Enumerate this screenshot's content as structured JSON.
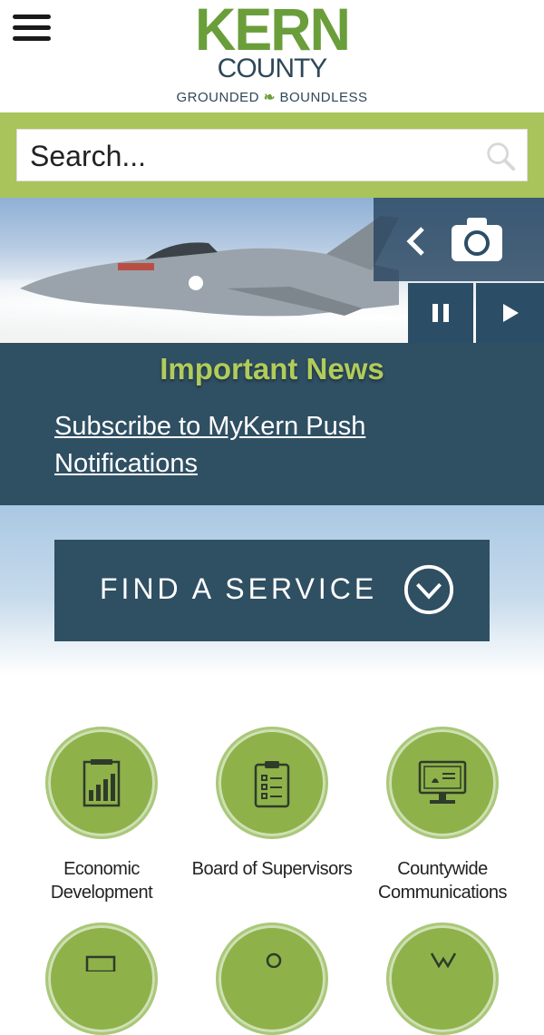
{
  "header": {
    "menu_icon": "hamburger-menu-icon",
    "logo": {
      "line1": "KERN",
      "line2": "COUNTY",
      "tagline_left": "GROUNDED",
      "tagline_right": "BOUNDLESS"
    }
  },
  "search": {
    "placeholder": "Search...",
    "icon": "search-icon"
  },
  "hero": {
    "controls": [
      "chevron-left-icon",
      "camera-icon",
      "pause-icon",
      "play-icon"
    ]
  },
  "news": {
    "title": "Important News",
    "link": "Subscribe to MyKern Push Notifications"
  },
  "find_service": {
    "label": "FIND A SERVICE",
    "icon": "chevron-down-circle-icon"
  },
  "tiles": [
    {
      "label": "Economic Development",
      "icon": "bar-chart-icon"
    },
    {
      "label": "Board of Supervisors",
      "icon": "clipboard-icon"
    },
    {
      "label": "Countywide Communications",
      "icon": "monitor-icon"
    },
    {
      "label": "",
      "icon": "document-icon"
    },
    {
      "label": "",
      "icon": "location-icon"
    },
    {
      "label": "",
      "icon": "people-icon"
    }
  ],
  "colors": {
    "green": "#a9c45a",
    "dark_blue": "#2f4f63",
    "tile_green": "#8eb14a"
  }
}
